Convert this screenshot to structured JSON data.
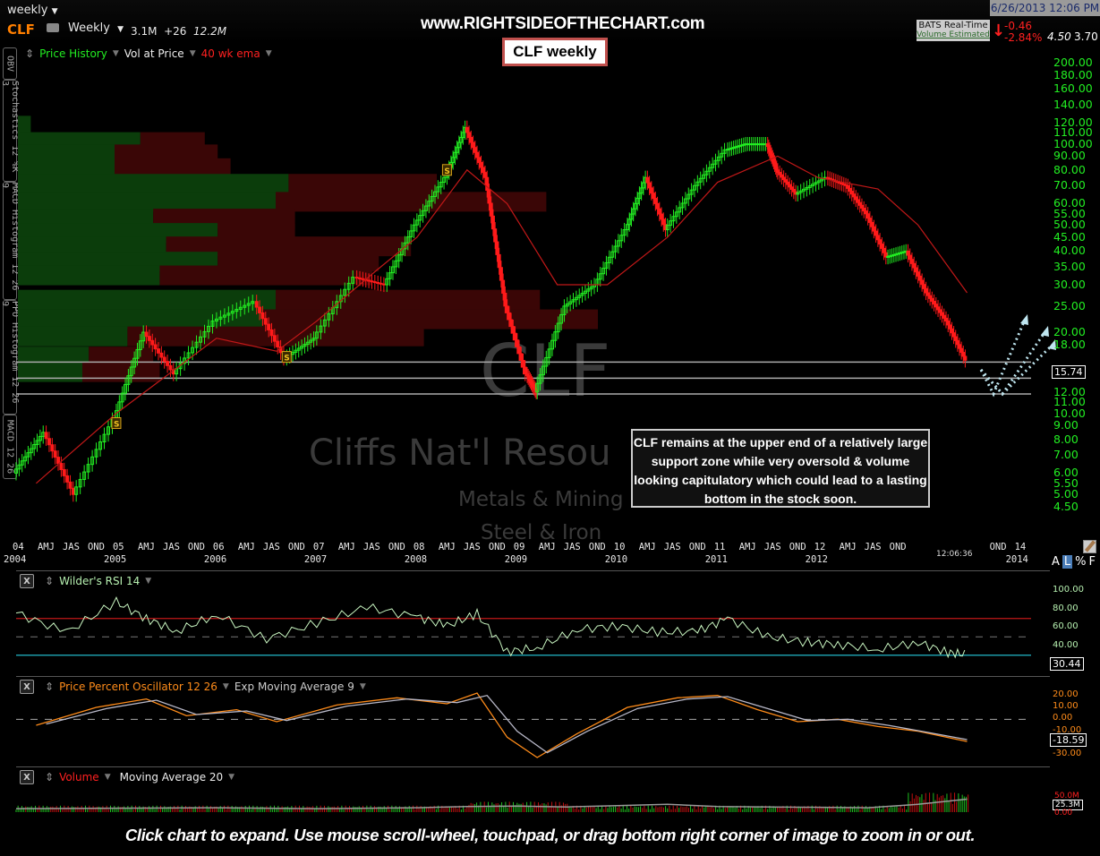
{
  "toolbar": {
    "period_dropdown": "weekly",
    "ticker": "CLF",
    "interval": "Weekly",
    "stat1": "3.1M",
    "stat2": "+26",
    "stat3": "12.2M",
    "datetime": "6/26/2013 12:06 PM",
    "feed_label": "BATS Real-Time",
    "feed_sub": "Volume Estimated",
    "change": "-0.46",
    "change_pct": "-2.84%",
    "val1": "4.50",
    "val2": "3.70",
    "colors": {
      "ticker": "#ff7f00",
      "up": "#22ee22",
      "down": "#ff2020",
      "accent_border": "#c0504d"
    }
  },
  "watermark": "www.RIGHTSIDEOFTHECHART.com",
  "title_box": "CLF weekly",
  "indicators_bar": {
    "price_history": "Price History",
    "vol_at_price": "Vol at Price",
    "ema": "40 wk ema"
  },
  "side_tabs": [
    "OBV",
    "Stochastics 12 %K 3",
    "MACD Histogram 12 26 9",
    "PPO Histogram 12 26 9",
    "MACD 12 26"
  ],
  "background_labels": {
    "symbol": "CLF",
    "company": "Cliffs Nat'l Resou",
    "sector": "Metals & Mining",
    "industry": "Steel & Iron"
  },
  "annotation": "CLF remains at the upper end of a relatively large support zone while very oversold & volume looking capitulatory which could lead to a lasting bottom in the stock soon.",
  "scale_buttons": [
    "A",
    "L",
    "%",
    "F"
  ],
  "clock": "12:06:36",
  "footer": "Click chart to expand. Use mouse scroll-wheel, touchpad, or drag bottom right corner of image to zoom in or out.",
  "chart_data": [
    {
      "type": "line",
      "title": "CLF weekly",
      "scale": "log",
      "ylim": [
        4.5,
        200
      ],
      "yticks": [
        "200.00",
        "180.00",
        "160.00",
        "140.00",
        "120.00",
        "110.00",
        "100.00",
        "90.00",
        "80.00",
        "70.00",
        "60.00",
        "55.00",
        "50.00",
        "45.00",
        "40.00",
        "35.00",
        "30.00",
        "25.00",
        "20.00",
        "18.00",
        "14.00",
        "12.00",
        "11.00",
        "10.00",
        "9.00",
        "8.00",
        "7.00",
        "6.00",
        "5.50",
        "5.00",
        "4.50"
      ],
      "x_month_labels": [
        "04",
        "AMJ",
        "JAS",
        "OND",
        "05",
        "AMJ",
        "JAS",
        "OND",
        "06",
        "AMJ",
        "JAS",
        "OND",
        "07",
        "AMJ",
        "JAS",
        "OND",
        "08",
        "AMJ",
        "JAS",
        "OND",
        "09",
        "AMJ",
        "JAS",
        "OND",
        "10",
        "AMJ",
        "JAS",
        "OND",
        "11",
        "AMJ",
        "JAS",
        "OND",
        "12",
        "AMJ",
        "JAS",
        "OND",
        "OND",
        "14"
      ],
      "x_year_labels": [
        "2004",
        "2005",
        "2006",
        "2007",
        "2008",
        "2009",
        "2010",
        "2011",
        "2012",
        "2014"
      ],
      "last_price": "15.74",
      "support_lines": [
        15.5,
        13.5,
        11.8
      ],
      "series": [
        {
          "name": "Price History",
          "x": [
            2004.0,
            2004.3,
            2004.6,
            2005.0,
            2005.3,
            2005.6,
            2006.0,
            2006.4,
            2006.7,
            2007.0,
            2007.4,
            2007.7,
            2008.0,
            2008.3,
            2008.5,
            2008.7,
            2008.9,
            2009.1,
            2009.2,
            2009.5,
            2009.8,
            2010.1,
            2010.3,
            2010.5,
            2010.8,
            2011.1,
            2011.3,
            2011.5,
            2011.6,
            2011.8,
            2012.1,
            2012.3,
            2012.5,
            2012.7,
            2012.9,
            2013.1,
            2013.3,
            2013.49
          ],
          "values": [
            6.0,
            8.5,
            5.0,
            9.5,
            20,
            14,
            22,
            26,
            16,
            19,
            32,
            30,
            50,
            75,
            115,
            75,
            25,
            14,
            12,
            25,
            30,
            48,
            75,
            48,
            70,
            95,
            100,
            100,
            80,
            65,
            75,
            70,
            55,
            38,
            40,
            28,
            22,
            15.74
          ]
        },
        {
          "name": "40 wk ema",
          "x": [
            2004.2,
            2005.0,
            2006.0,
            2006.6,
            2007.0,
            2007.6,
            2008.0,
            2008.5,
            2008.9,
            2009.4,
            2009.9,
            2010.5,
            2011.0,
            2011.6,
            2012.0,
            2012.6,
            2013.0,
            2013.49
          ],
          "values": [
            5.5,
            10,
            19,
            17,
            22,
            34,
            45,
            80,
            60,
            30,
            30,
            45,
            72,
            90,
            75,
            68,
            50,
            28
          ]
        }
      ],
      "volume_at_price": [
        {
          "price": 115,
          "up": 0.02,
          "down": 0.0
        },
        {
          "price": 100,
          "up": 0.19,
          "down": 0.1
        },
        {
          "price": 90,
          "up": 0.15,
          "down": 0.16
        },
        {
          "price": 80,
          "up": 0.15,
          "down": 0.18
        },
        {
          "price": 70,
          "up": 0.42,
          "down": 0.23
        },
        {
          "price": 60,
          "up": 0.4,
          "down": 0.42
        },
        {
          "price": 52,
          "up": 0.21,
          "down": 0.22
        },
        {
          "price": 46,
          "up": 0.31,
          "down": 0.12
        },
        {
          "price": 41,
          "up": 0.23,
          "down": 0.38
        },
        {
          "price": 36,
          "up": 0.31,
          "down": 0.25
        },
        {
          "price": 32,
          "up": 0.22,
          "down": 0.33
        },
        {
          "price": 26,
          "up": 0.4,
          "down": 0.41
        },
        {
          "price": 22,
          "up": 0.38,
          "down": 0.52
        },
        {
          "price": 19,
          "up": 0.17,
          "down": 0.46
        },
        {
          "price": 16,
          "up": 0.11,
          "down": 0.1
        },
        {
          "price": 14,
          "up": 0.1,
          "down": 0.12
        }
      ]
    },
    {
      "type": "line",
      "title": "Wilder's RSI 14",
      "ylim": [
        20,
        100
      ],
      "yticks": [
        "100.00",
        "80.00",
        "60.00",
        "40.00"
      ],
      "levels": [
        70,
        50,
        30
      ],
      "last_value": "30.44",
      "series": [
        {
          "name": "RSI 14",
          "x": [
            2004.0,
            2004.5,
            2005.0,
            2005.3,
            2005.6,
            2006.0,
            2006.5,
            2007.0,
            2007.5,
            2008.0,
            2008.3,
            2008.6,
            2008.9,
            2009.2,
            2009.6,
            2010.0,
            2010.4,
            2010.8,
            2011.1,
            2011.5,
            2011.9,
            2012.2,
            2012.6,
            2013.0,
            2013.3,
            2013.49
          ],
          "values": [
            76,
            55,
            88,
            70,
            56,
            74,
            48,
            65,
            82,
            72,
            62,
            75,
            34,
            38,
            58,
            62,
            55,
            56,
            70,
            50,
            44,
            42,
            36,
            44,
            33,
            30.44
          ]
        }
      ]
    },
    {
      "type": "line",
      "title": "Price Percent Oscillator 12 26",
      "ylim": [
        -35,
        25
      ],
      "yticks": [
        "20.00",
        "10.00",
        "0.00",
        "-10.00",
        "-30.00"
      ],
      "last_value": "-18.59",
      "series": [
        {
          "name": "PPO 12 26",
          "x": [
            2004.2,
            2004.8,
            2005.3,
            2005.7,
            2006.2,
            2006.6,
            2007.2,
            2007.8,
            2008.3,
            2008.6,
            2008.9,
            2009.2,
            2009.6,
            2010.1,
            2010.6,
            2011.0,
            2011.4,
            2011.8,
            2012.2,
            2012.6,
            2013.0,
            2013.49
          ],
          "values": [
            -5,
            10,
            17,
            3,
            8,
            -2,
            12,
            18,
            13,
            22,
            -15,
            -32,
            -12,
            10,
            18,
            20,
            8,
            -2,
            0,
            -6,
            -10,
            -18.59
          ]
        },
        {
          "name": "Exp Moving Average 9",
          "x": [
            2004.3,
            2004.9,
            2005.4,
            2005.8,
            2006.3,
            2006.7,
            2007.3,
            2007.9,
            2008.4,
            2008.7,
            2009.0,
            2009.3,
            2009.7,
            2010.2,
            2010.7,
            2011.1,
            2011.5,
            2011.9,
            2012.3,
            2012.7,
            2013.1,
            2013.49
          ],
          "values": [
            -4,
            9,
            16,
            4,
            7,
            -1,
            11,
            17,
            14,
            20,
            -10,
            -28,
            -10,
            9,
            17,
            19,
            9,
            -1,
            0,
            -5,
            -11,
            -17
          ]
        }
      ]
    },
    {
      "type": "bar",
      "title": "Volume",
      "overlay": "Moving Average 20",
      "yticks": [
        "50.0M",
        "0.00"
      ],
      "last_value": "25.3M",
      "ylim": [
        0,
        60
      ],
      "ma_x": [
        2004.0,
        2005.0,
        2006.0,
        2007.0,
        2008.0,
        2008.5,
        2009.0,
        2009.5,
        2010.0,
        2010.5,
        2011.0,
        2011.5,
        2012.0,
        2012.5,
        2013.0,
        2013.49
      ],
      "ma_values": [
        8,
        9,
        10,
        8,
        10,
        13,
        14,
        12,
        15,
        18,
        13,
        12,
        11,
        10,
        18,
        30
      ]
    }
  ]
}
